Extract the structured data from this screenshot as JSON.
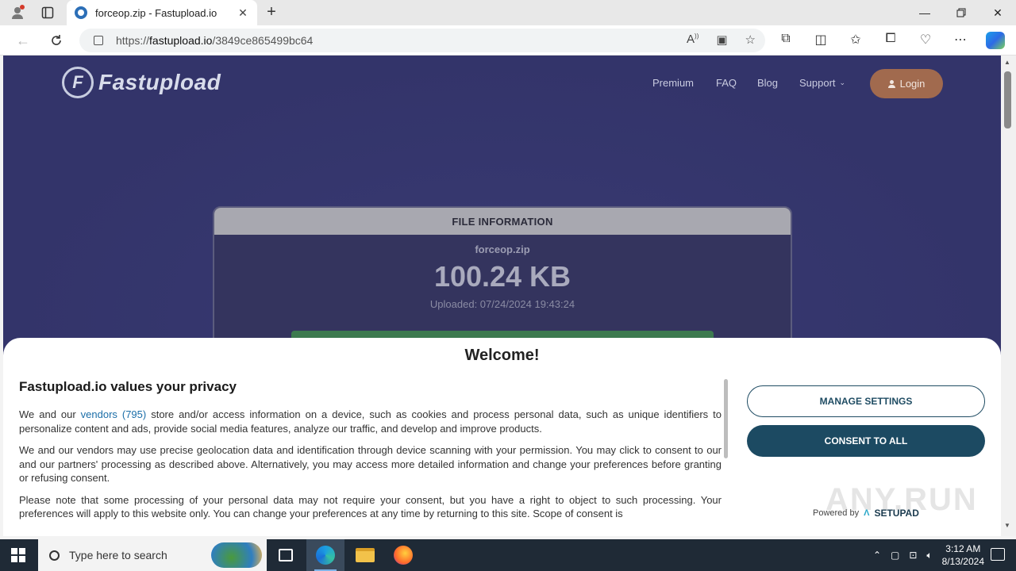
{
  "browser": {
    "tab_title": "forceop.zip - Fastupload.io",
    "url_prefix": "https://",
    "url_domain": "fastupload.io",
    "url_path": "/3849ce865499bc64"
  },
  "site": {
    "logo_text": "Fastupload",
    "logo_mark": "F",
    "nav": {
      "premium": "Premium",
      "faq": "FAQ",
      "blog": "Blog",
      "support": "Support"
    },
    "login_label": "Login"
  },
  "file": {
    "header": "FILE INFORMATION",
    "name": "forceop.zip",
    "size": "100.24 KB",
    "uploaded": "Uploaded: 07/24/2024 19:43:24"
  },
  "consent": {
    "welcome": "Welcome!",
    "title": "Fastupload.io values your privacy",
    "p1_before": "We and our ",
    "p1_link": "vendors (795)",
    "p1_after": " store and/or access information on a device, such as cookies and process personal data, such as unique identifiers to personalize content and ads, provide social media features, analyze our traffic, and develop and improve products.",
    "p2": "We and our vendors may use precise geolocation data and identification through device scanning with your permission. You may click to consent to our and our partners' processing as described above. Alternatively, you may access more detailed information and change your preferences before granting or refusing consent.",
    "p3": "Please note that some processing of your personal data may not require your consent, but you have a right to object to such processing. Your preferences will apply to this website only. You can change your preferences at any time by returning to this site. Scope of consent is",
    "manage_label": "MANAGE SETTINGS",
    "consent_label": "CONSENT TO ALL",
    "powered_by": "Powered by",
    "powered_brand": "SETUPAD",
    "watermark": "ANY.RUN"
  },
  "taskbar": {
    "search_placeholder": "Type here to search",
    "time": "3:12 AM",
    "date": "8/13/2024"
  }
}
